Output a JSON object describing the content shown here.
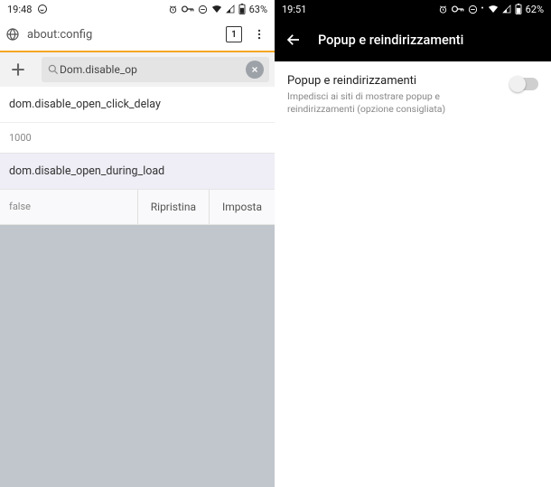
{
  "left": {
    "status": {
      "time": "19:48",
      "battery": "63%"
    },
    "url": "about:config",
    "tab_count": "1",
    "search_value": "Dom.disable_op",
    "prefs": [
      {
        "name": "dom.disable_open_click_delay",
        "value": "1000"
      },
      {
        "name": "dom.disable_open_during_load",
        "value": "false"
      }
    ],
    "actions": {
      "reset": "Ripristina",
      "set": "Imposta"
    }
  },
  "right": {
    "status": {
      "time": "19:51",
      "battery": "62%"
    },
    "header": "Popup e reindirizzamenti",
    "setting": {
      "title": "Popup e reindirizzamenti",
      "desc": "Impedisci ai siti di mostrare popup e reindirizzamenti (opzione consigliata)"
    }
  }
}
